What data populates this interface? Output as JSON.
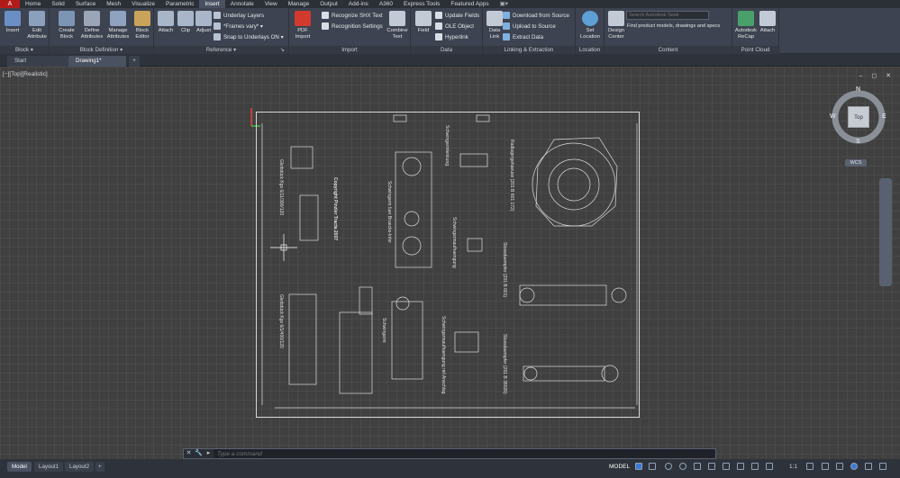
{
  "menubar": {
    "logo": "A",
    "tabs": [
      "Home",
      "Solid",
      "Surface",
      "Mesh",
      "Visualize",
      "Parametric",
      "Insert",
      "Annotate",
      "View",
      "Manage",
      "Output",
      "Add-ins",
      "A360",
      "Express Tools",
      "Featured Apps"
    ],
    "active_tab": "Insert",
    "extra": "▣▾"
  },
  "ribbon": {
    "block": {
      "insert": "Insert",
      "edit_attribute": "Edit\nAttribute",
      "footer": "Block ▾"
    },
    "block_definition": {
      "create_block": "Create\nBlock",
      "define_attributes": "Define\nAttributes",
      "manage_attributes": "Manage\nAttributes",
      "block_editor": "Block\nEditor",
      "footer": "Block Definition ▾"
    },
    "reference": {
      "attach": "Attach",
      "clip": "Clip",
      "adjust": "Adjust",
      "underlay_layers": "Underlay Layers",
      "frames_vary": "*Frames vary*",
      "snap_underlays": "Snap to Underlays ON",
      "footer": "Reference ▾",
      "footer_arrow": "↘"
    },
    "import": {
      "pdf_import": "PDF\nImport",
      "recognize_shx": "Recognize SHX Text",
      "recognition_settings": "Recognition Settings",
      "combine_text": "Combine\nText",
      "footer": "Import"
    },
    "data": {
      "field": "Field",
      "update_fields": "Update Fields",
      "ole_object": "OLE Object",
      "hyperlink": "Hyperlink",
      "footer": "Data"
    },
    "linking": {
      "data_link": "Data\nLink",
      "download_source": "Download from Source",
      "upload_source": "Upload to Source",
      "extract_data": "Extract  Data",
      "footer": "Linking & Extraction"
    },
    "location": {
      "set_location": "Set\nLocation",
      "footer": "Location"
    },
    "content": {
      "design_center": "Design\nCenter",
      "search_placeholder": "Search Autodesk Seek",
      "seek_text": "Find product models, drawings and specs",
      "footer": "Content"
    },
    "point_cloud": {
      "recap": "Autodesk\nReCap",
      "attach": "Attach",
      "footer": "Point Cloud"
    }
  },
  "doctabs": {
    "start": "Start",
    "drawing": "Drawing1*",
    "add": "+"
  },
  "viewport": {
    "label": "[−][Top][Realistic]",
    "controls": "– ◻ ✕"
  },
  "drawing_texts": {
    "copyright": "Copyright Pinzler Tracta 2007",
    "t1": "Gleitstück Kgs 6/11/390/120",
    "t2": "Gleitstück Kgs 6/1/400/120",
    "t3": "Schwingarm fuer Bruecke-Infer",
    "t4": "Schwingarmlenkung",
    "t5": "Schwingarmaufhaengung",
    "t6": "Schwingarm",
    "t7": "Schwingarmaufhaengung mit Anschlag",
    "t8": "Radlagergehaeuse (201 B 601 172)",
    "t9": "Stossdaempfer (201 B 601)",
    "t10": "Stossdaempfer (201 B 38026)"
  },
  "navcube": {
    "n": "N",
    "s": "S",
    "e": "E",
    "w": "W",
    "top": "Top",
    "wcs": "WCS"
  },
  "command": {
    "close": "✕",
    "settings": "🔧",
    "recent": "▸",
    "placeholder": "Type a command"
  },
  "status": {
    "model_tab": "Model",
    "layout1": "Layout1",
    "layout2": "Layout2",
    "add": "+",
    "model_btn": "MODEL",
    "scale": "1:1"
  }
}
